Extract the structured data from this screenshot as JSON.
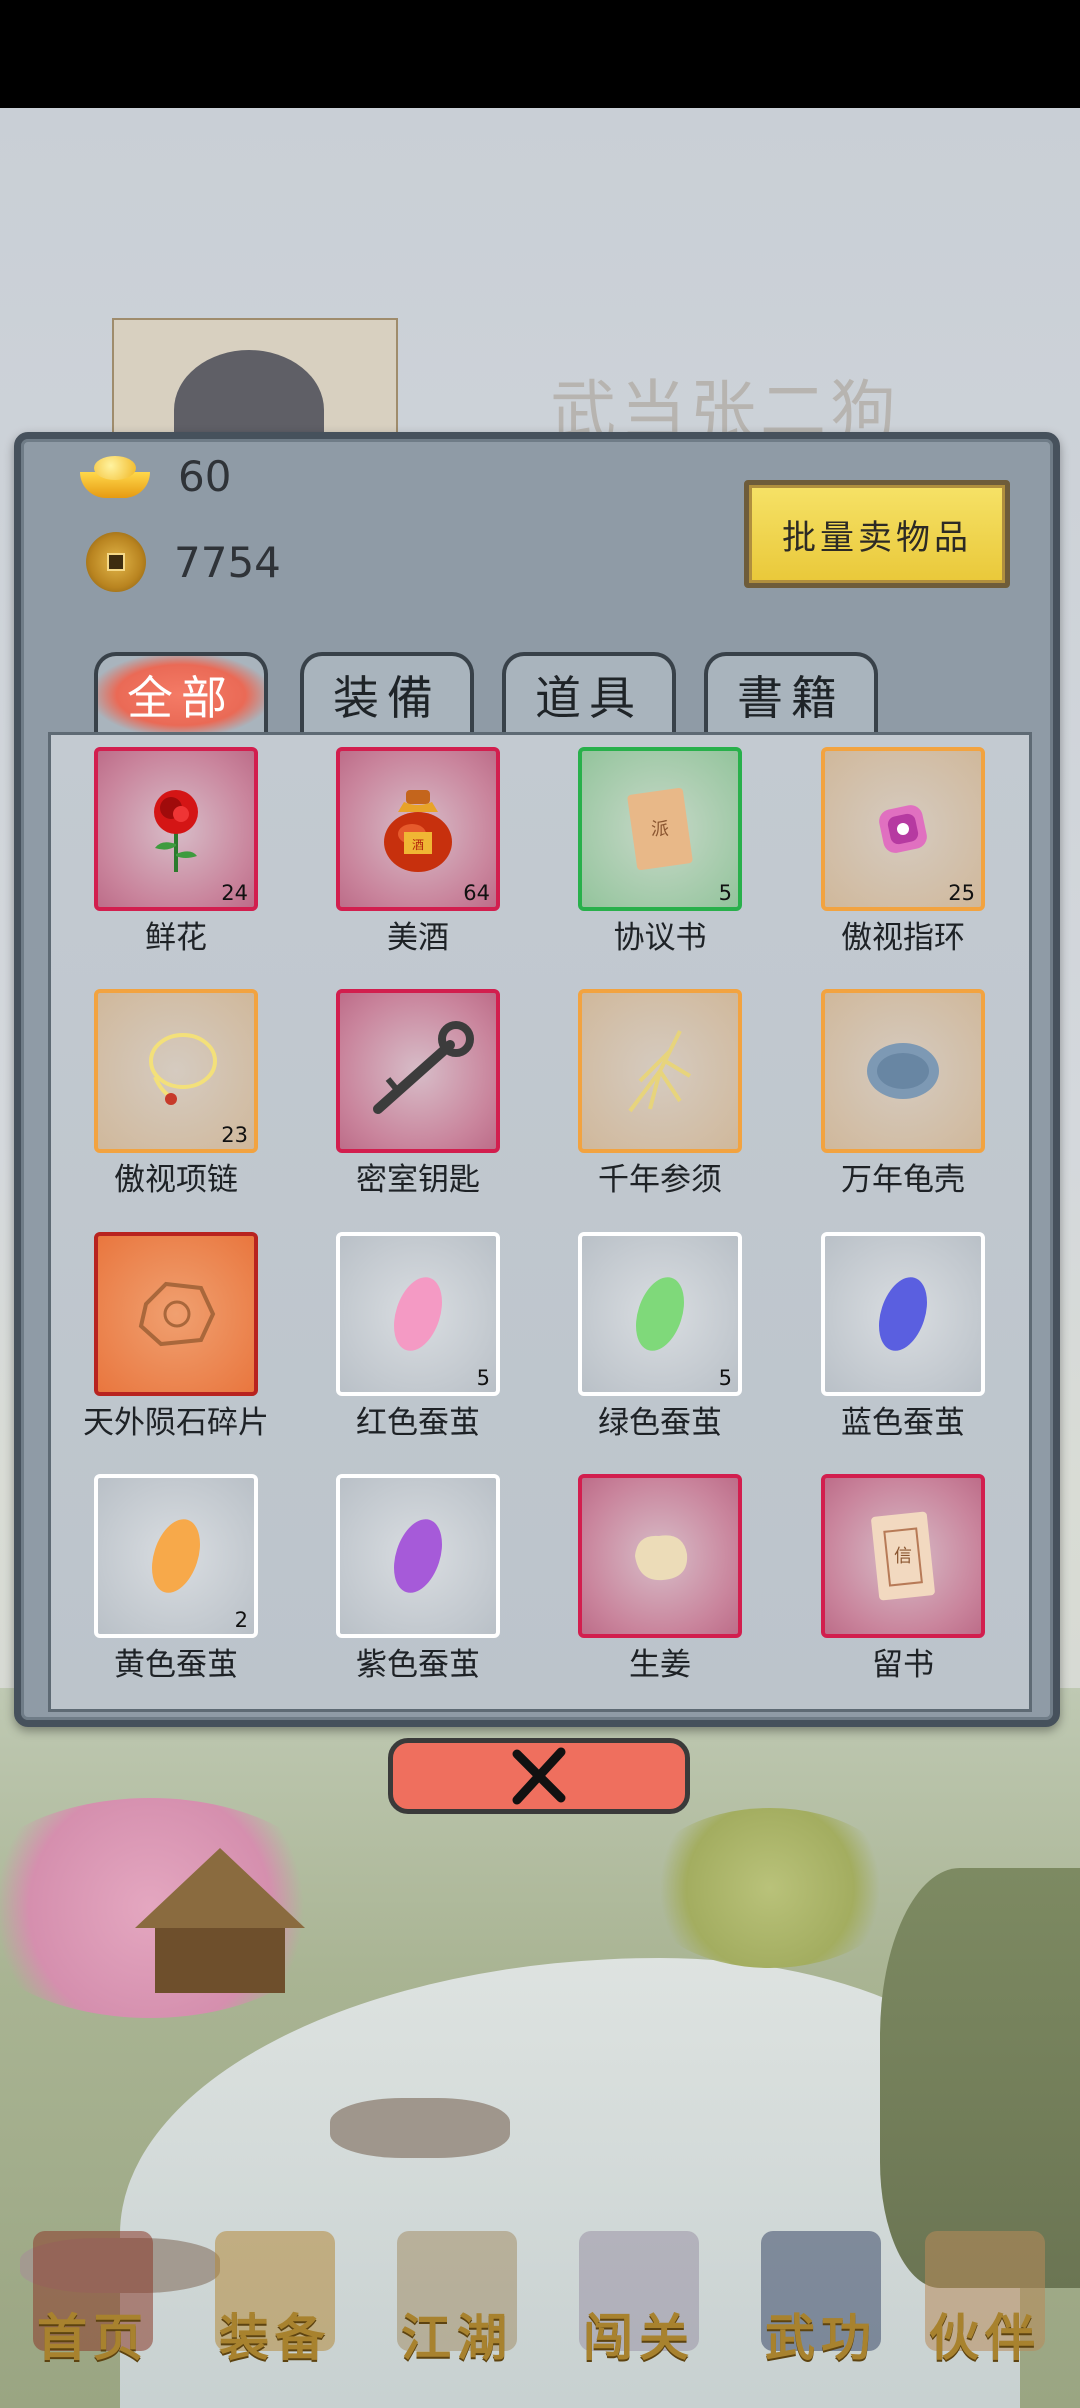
{
  "header": {
    "player_name": "武当张二狗"
  },
  "currency": {
    "gold": "60",
    "coins": "7754"
  },
  "sell_button": {
    "label": "批量卖物品"
  },
  "tabs": [
    {
      "label": "全部",
      "active": true
    },
    {
      "label": "装備",
      "active": false
    },
    {
      "label": "道具",
      "active": false
    },
    {
      "label": "書籍",
      "active": false
    }
  ],
  "items": [
    {
      "name": "鲜花",
      "count": "24",
      "rarity": "red",
      "icon": "rose-icon"
    },
    {
      "name": "美酒",
      "count": "64",
      "rarity": "red",
      "icon": "wine-jar-icon"
    },
    {
      "name": "协议书",
      "count": "5",
      "rarity": "green",
      "icon": "scroll-icon"
    },
    {
      "name": "傲视指环",
      "count": "25",
      "rarity": "orange",
      "icon": "ring-icon"
    },
    {
      "name": "傲视项链",
      "count": "23",
      "rarity": "orange",
      "icon": "necklace-icon"
    },
    {
      "name": "密室钥匙",
      "count": "",
      "rarity": "red",
      "icon": "key-icon"
    },
    {
      "name": "千年参须",
      "count": "",
      "rarity": "orange",
      "icon": "ginseng-icon"
    },
    {
      "name": "万年龟壳",
      "count": "",
      "rarity": "orange",
      "icon": "turtle-shell-icon"
    },
    {
      "name": "天外陨石碎片",
      "count": "",
      "rarity": "red-dark",
      "icon": "meteorite-icon"
    },
    {
      "name": "红色蚕茧",
      "count": "5",
      "rarity": "white",
      "icon": "cocoon-pink-icon",
      "color": "#f49ac4"
    },
    {
      "name": "绿色蚕茧",
      "count": "5",
      "rarity": "white",
      "icon": "cocoon-green-icon",
      "color": "#7fd97a"
    },
    {
      "name": "蓝色蚕茧",
      "count": "",
      "rarity": "white",
      "icon": "cocoon-blue-icon",
      "color": "#5a5fe0"
    },
    {
      "name": "黄色蚕茧",
      "count": "2",
      "rarity": "white",
      "icon": "cocoon-yellow-icon",
      "color": "#f7a94a"
    },
    {
      "name": "紫色蚕茧",
      "count": "",
      "rarity": "white",
      "icon": "cocoon-purple-icon",
      "color": "#a65ad9"
    },
    {
      "name": "生姜",
      "count": "",
      "rarity": "red",
      "icon": "ginger-icon"
    },
    {
      "name": "留书",
      "count": "",
      "rarity": "red",
      "icon": "letter-icon"
    }
  ],
  "close_button": {
    "icon": "close-icon"
  },
  "bottom_nav": [
    {
      "label": "首页",
      "icon": "home-icon"
    },
    {
      "label": "装备",
      "icon": "armor-icon"
    },
    {
      "label": "江湖",
      "icon": "map-scroll-icon"
    },
    {
      "label": "闯关",
      "icon": "crossed-swords-icon"
    },
    {
      "label": "武功",
      "icon": "book-icon"
    },
    {
      "label": "伙伴",
      "icon": "companions-icon"
    }
  ]
}
